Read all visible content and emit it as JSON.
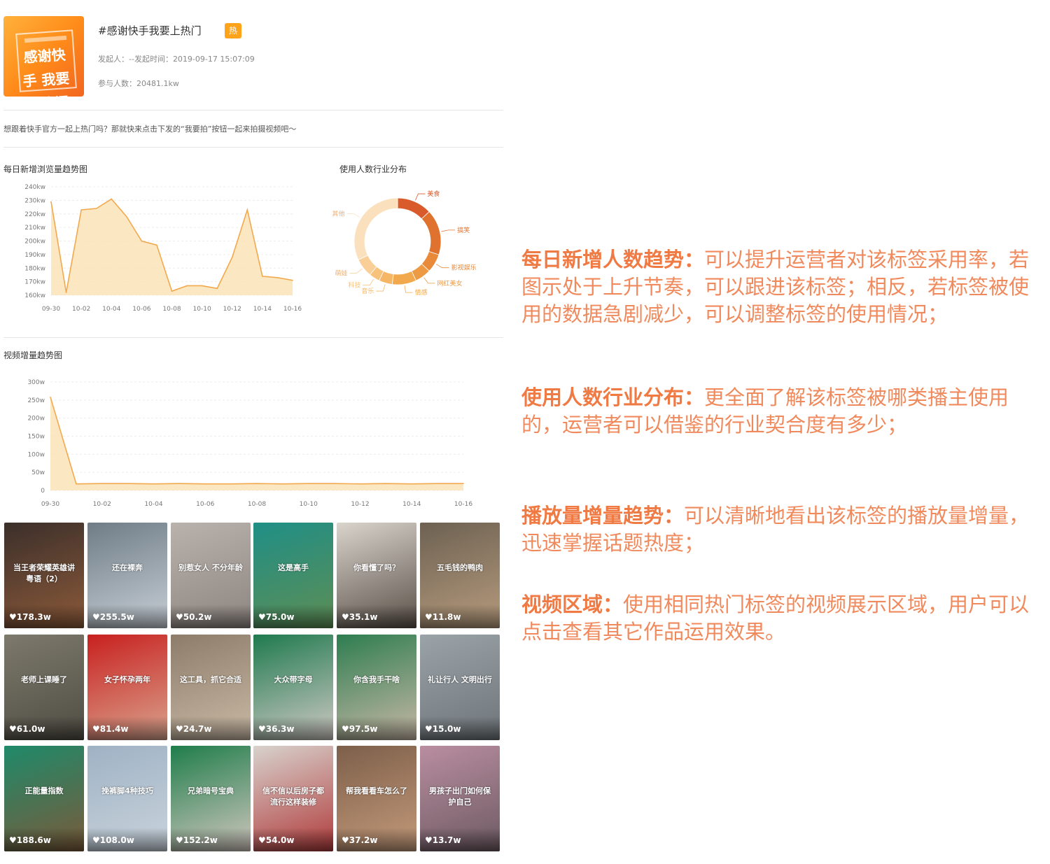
{
  "header": {
    "cover_text": "感谢快手 我要上热门",
    "title": "#感谢快手我要上热门",
    "badge": "热",
    "meta_line1": "发起人：--发起时间：2019-09-17 15:07:09",
    "meta_line2": "参与人数：20481.1kw"
  },
  "description": "想跟着快手官方一起上热门吗？那就快来点击下发的“我要拍”按钮一起来拍摄视频吧～",
  "chart_browse": {
    "title": "每日新增浏览量趋势图"
  },
  "chart_pie": {
    "title": "使用人数行业分布"
  },
  "chart_video": {
    "title": "视频增量趋势图"
  },
  "chart_data": [
    {
      "type": "area",
      "title": "每日新增浏览量趋势图",
      "x": [
        "09-30",
        "10-01",
        "10-02",
        "10-03",
        "10-04",
        "10-05",
        "10-06",
        "10-07",
        "10-08",
        "10-09",
        "10-10",
        "10-11",
        "10-12",
        "10-13",
        "10-14",
        "10-15",
        "10-16"
      ],
      "x_ticks": [
        "09-30",
        "10-02",
        "10-04",
        "10-06",
        "10-08",
        "10-10",
        "10-12",
        "10-14",
        "10-16"
      ],
      "values": [
        229,
        162,
        223,
        224,
        231,
        218,
        200,
        197,
        163,
        167,
        167,
        165,
        188,
        223,
        174,
        173,
        171
      ],
      "y_ticks": [
        "240kw",
        "230kw",
        "220kw",
        "210kw",
        "200kw",
        "190kw",
        "180kw",
        "170kw",
        "160kw"
      ],
      "ylim": [
        160,
        240
      ],
      "grid": true,
      "color": "#f2a94e"
    },
    {
      "type": "pie",
      "title": "使用人数行业分布",
      "labels": [
        "美食",
        "搞笑",
        "影视娱乐",
        "网红美女",
        "情感",
        "音乐",
        "科技",
        "萌娃",
        "其他"
      ],
      "values": [
        13,
        17,
        7,
        6,
        9,
        5,
        4,
        7,
        32
      ],
      "colors": [
        "#d95b2b",
        "#e0722f",
        "#e98a3a",
        "#ee9a44",
        "#f2a94e",
        "#f5b765",
        "#f7c27b",
        "#f9cf97",
        "#fbe0bd"
      ]
    },
    {
      "type": "area",
      "title": "视频增量趋势图",
      "x": [
        "09-30",
        "10-01",
        "10-02",
        "10-03",
        "10-04",
        "10-05",
        "10-06",
        "10-07",
        "10-08",
        "10-09",
        "10-10",
        "10-11",
        "10-12",
        "10-13",
        "10-14",
        "10-15",
        "10-16"
      ],
      "x_ticks": [
        "09-30",
        "10-02",
        "10-04",
        "10-06",
        "10-08",
        "10-10",
        "10-12",
        "10-14",
        "10-16"
      ],
      "values": [
        258,
        18,
        19,
        19,
        18,
        19,
        18,
        18,
        19,
        18,
        19,
        19,
        18,
        19,
        18,
        19,
        19
      ],
      "y_ticks": [
        "300w",
        "250w",
        "200w",
        "150w",
        "100w",
        "50w",
        "0"
      ],
      "ylim": [
        0,
        300
      ],
      "grid": true,
      "color": "#f2a94e"
    }
  ],
  "videos": [
    {
      "likes": "178.3w",
      "caption": "当王者荣耀英雄讲粤语（2）",
      "c1": "#3b2f2a",
      "c2": "#8c5a3a"
    },
    {
      "likes": "255.5w",
      "caption": "还在裸奔",
      "c1": "#6f7c86",
      "c2": "#c7cfd6"
    },
    {
      "likes": "50.2w",
      "caption": "别惹女人 不分年龄",
      "c1": "#b9b2ad",
      "c2": "#8d8580"
    },
    {
      "likes": "75.0w",
      "caption": "这是高手",
      "c1": "#1f8f86",
      "c2": "#5e8d54"
    },
    {
      "likes": "35.1w",
      "caption": "你看懂了吗？",
      "c1": "#d9d4cc",
      "c2": "#5a5048"
    },
    {
      "likes": "11.8w",
      "caption": "五毛钱的鸭肉",
      "c1": "#6d6152",
      "c2": "#b69b7d"
    },
    {
      "likes": "61.0w",
      "caption": "老师上课睡了",
      "c1": "#7d7a6c",
      "c2": "#4f4c43"
    },
    {
      "likes": "81.4w",
      "caption": "女子怀孕两年",
      "c1": "#c8201f",
      "c2": "#d9a38d"
    },
    {
      "likes": "24.7w",
      "caption": "这工具，抓它合适",
      "c1": "#8e7c6a",
      "c2": "#c9b9a5"
    },
    {
      "likes": "36.3w",
      "caption": "大众带字母",
      "c1": "#1f7a4f",
      "c2": "#cfc9c4"
    },
    {
      "likes": "97.5w",
      "caption": "你含我手干啥",
      "c1": "#2e7d50",
      "c2": "#c7b8a6"
    },
    {
      "likes": "15.0w",
      "caption": "礼让行人 文明出行",
      "c1": "#9aa3a8",
      "c2": "#6f757a"
    },
    {
      "likes": "188.6w",
      "caption": "正能量指数",
      "c1": "#1e8a6a",
      "c2": "#7a5a3a"
    },
    {
      "likes": "108.0w",
      "caption": "挽裤脚4种技巧",
      "c1": "#9fb2c4",
      "c2": "#c9d3dc"
    },
    {
      "likes": "152.2w",
      "caption": "兄弟暗号宝典",
      "c1": "#1f7d4a",
      "c2": "#d1c7bf"
    },
    {
      "likes": "54.0w",
      "caption": "信不信以后房子都流行这样装修",
      "c1": "#d8d2cd",
      "c2": "#b03b3b"
    },
    {
      "likes": "37.2w",
      "caption": "帮我看看车怎么了",
      "c1": "#7d5f4a",
      "c2": "#c49a7a"
    },
    {
      "likes": "13.7w",
      "caption": "男孩子出门如何保护自己",
      "c1": "#b98ea0",
      "c2": "#6d5a62"
    }
  ],
  "explanations": [
    {
      "heading": "每日新增人数趋势：",
      "body": "可以提升运营者对该标签采用率，若图示处于上升节奏，可以跟进该标签；相反，若标签被使用的数据急剧减少，可以调整标签的使用情况；"
    },
    {
      "heading": "使用人数行业分布：",
      "body": "更全面了解该标签被哪类播主使用的，运营者可以借鉴的行业契合度有多少；"
    },
    {
      "heading": "播放量增量趋势：",
      "body": "可以清晰地看出该标签的播放量增量，迅速掌握话题热度；"
    },
    {
      "heading": "视频区域：",
      "body": "使用相同热门标签的视频展示区域，用户可以点击查看其它作品运用效果。"
    }
  ]
}
